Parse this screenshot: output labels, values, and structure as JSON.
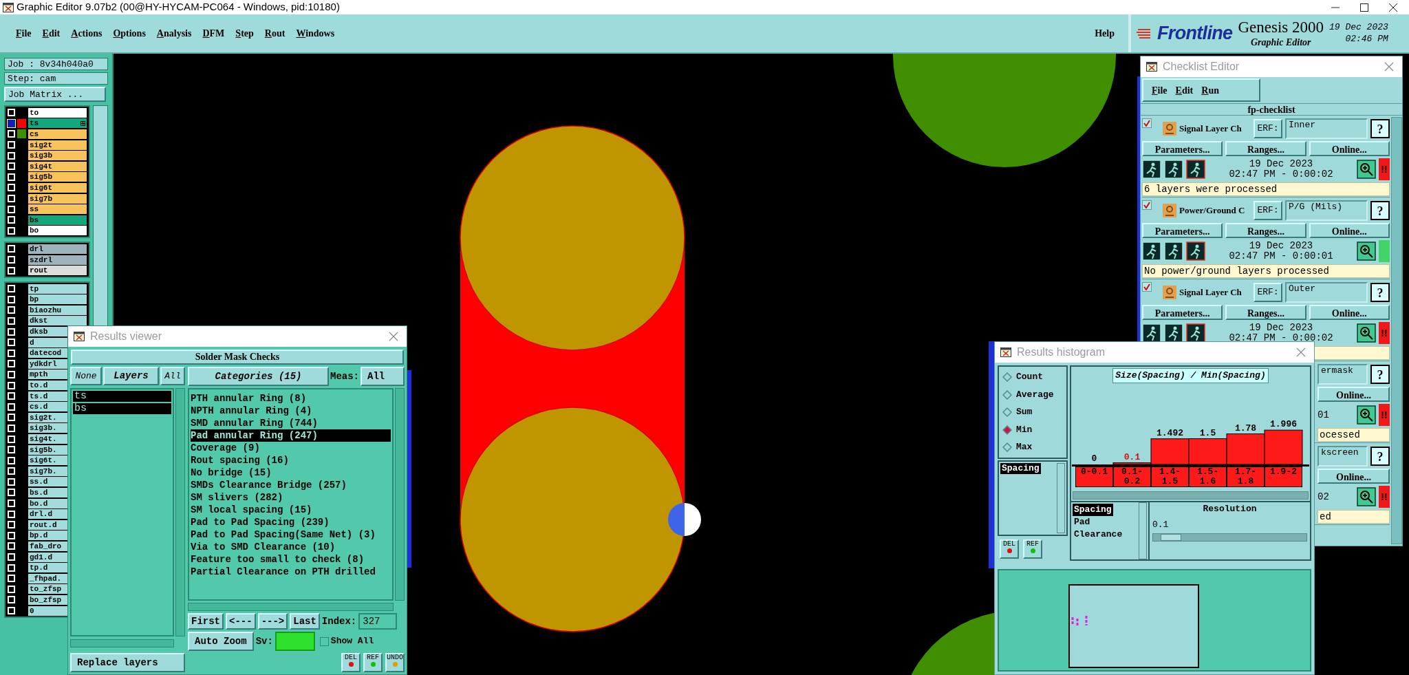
{
  "app": {
    "title": "Graphic Editor 9.07b2 (00@HY-HYCAM-PC064 - Windows, pid:10180)",
    "menu": [
      "File",
      "Edit",
      "Actions",
      "Options",
      "Analysis",
      "DFM",
      "Step",
      "Rout",
      "Windows"
    ],
    "help": "Help",
    "logo": {
      "brand": "Frontline",
      "product": "Genesis 2000",
      "subtitle": "Graphic Editor",
      "date": "19 Dec 2023",
      "time": "02:46 PM"
    }
  },
  "job_panel": {
    "job": "Job : 8v34h040a0",
    "step": "Step: cam",
    "matrix_button": "Job Matrix ...",
    "layer_groups": [
      [
        {
          "name": "to",
          "kind": "silk_screen",
          "affected": false,
          "work": false
        },
        {
          "name": "ts",
          "kind": "solder_mask",
          "affected": true,
          "work": true,
          "color": "#ff0000"
        },
        {
          "name": "cs",
          "kind": "signal",
          "affected": false,
          "work": false,
          "color": "#3f8f00"
        },
        {
          "name": "sig2t",
          "kind": "signal",
          "affected": false,
          "work": false
        },
        {
          "name": "sig3b",
          "kind": "signal",
          "affected": false,
          "work": false
        },
        {
          "name": "sig4t",
          "kind": "signal",
          "affected": false,
          "work": false
        },
        {
          "name": "sig5b",
          "kind": "signal",
          "affected": false,
          "work": false
        },
        {
          "name": "sig6t",
          "kind": "signal",
          "affected": false,
          "work": false
        },
        {
          "name": "sig7b",
          "kind": "signal",
          "affected": false,
          "work": false
        },
        {
          "name": "ss",
          "kind": "signal",
          "affected": false,
          "work": false
        },
        {
          "name": "bs",
          "kind": "solder_mask",
          "affected": false,
          "work": false
        },
        {
          "name": "bo",
          "kind": "silk_screen",
          "affected": false,
          "work": false
        }
      ],
      [
        {
          "name": "drl",
          "kind": "drill",
          "affected": false,
          "work": false
        },
        {
          "name": "szdrl",
          "kind": "drill",
          "affected": false,
          "work": false
        },
        {
          "name": "rout",
          "kind": "rout",
          "affected": false,
          "work": false
        }
      ],
      [
        {
          "name": "tp",
          "kind": "misc",
          "affected": false,
          "work": false
        },
        {
          "name": "bp",
          "kind": "misc",
          "affected": false,
          "work": false
        },
        {
          "name": "biaozhu",
          "kind": "misc",
          "affected": false,
          "work": false
        },
        {
          "name": "dkst",
          "kind": "misc",
          "affected": false,
          "work": false
        },
        {
          "name": "dksb",
          "kind": "misc",
          "affected": false
        },
        {
          "name": "d",
          "kind": "misc",
          "affected": false
        },
        {
          "name": "datecod",
          "kind": "misc",
          "affected": false
        },
        {
          "name": "ydkdrl",
          "kind": "misc",
          "affected": false
        },
        {
          "name": "mpth",
          "kind": "misc",
          "affected": false
        },
        {
          "name": "to.d",
          "kind": "misc",
          "affected": false
        },
        {
          "name": "ts.d",
          "kind": "misc",
          "affected": false
        },
        {
          "name": "cs.d",
          "kind": "misc",
          "affected": false
        },
        {
          "name": "sig2t.",
          "kind": "misc",
          "affected": false
        },
        {
          "name": "sig3b.",
          "kind": "misc",
          "affected": false
        },
        {
          "name": "sig4t.",
          "kind": "misc",
          "affected": false
        },
        {
          "name": "sig5b.",
          "kind": "misc",
          "affected": false
        },
        {
          "name": "sig6t.",
          "kind": "misc",
          "affected": false
        },
        {
          "name": "sig7b.",
          "kind": "misc",
          "affected": false
        },
        {
          "name": "ss.d",
          "kind": "misc",
          "affected": false
        },
        {
          "name": "bs.d",
          "kind": "misc",
          "affected": false
        },
        {
          "name": "bo.d",
          "kind": "misc",
          "affected": false
        },
        {
          "name": "drl.d",
          "kind": "misc",
          "affected": false
        },
        {
          "name": "rout.d",
          "kind": "misc",
          "affected": false
        },
        {
          "name": "bp.d",
          "kind": "misc",
          "affected": false
        },
        {
          "name": "fab_dro",
          "kind": "misc",
          "affected": false
        },
        {
          "name": "gd1.d",
          "kind": "misc",
          "affected": false
        },
        {
          "name": "tp.d",
          "kind": "misc",
          "affected": false
        },
        {
          "name": "_fhpad.",
          "kind": "misc",
          "affected": false
        },
        {
          "name": "to_zfsp",
          "kind": "misc",
          "affected": false
        },
        {
          "name": "bo_zfsp",
          "kind": "misc",
          "affected": false
        },
        {
          "name": "0",
          "kind": "misc",
          "affected": false
        }
      ]
    ]
  },
  "results_viewer": {
    "title": "Results viewer",
    "header": "Solder Mask Checks",
    "none_button": "None",
    "layers_button": "Layers",
    "all_button": "All",
    "layers": [
      {
        "label": "ts",
        "selected": true
      },
      {
        "label": "bs",
        "selected": true
      }
    ],
    "categories_button": "Categories (15)",
    "meas_label": "Meas:",
    "meas_value": "All",
    "categories": [
      {
        "label": "PTH annular Ring (8)",
        "selected": false
      },
      {
        "label": "NPTH annular Ring (4)",
        "selected": false
      },
      {
        "label": "SMD annular Ring (744)",
        "selected": false
      },
      {
        "label": "Pad annular Ring (247)",
        "selected": true
      },
      {
        "label": "Coverage (9)",
        "selected": false
      },
      {
        "label": "Rout spacing (16)",
        "selected": false
      },
      {
        "label": "No bridge (15)",
        "selected": false
      },
      {
        "label": "SMDs Clearance Bridge (257)",
        "selected": false
      },
      {
        "label": "SM slivers (282)",
        "selected": false
      },
      {
        "label": "SM local spacing (15)",
        "selected": false
      },
      {
        "label": "Pad to Pad Spacing (239)",
        "selected": false
      },
      {
        "label": "Pad to Pad Spacing(Same Net) (3)",
        "selected": false
      },
      {
        "label": "Via to SMD Clearance (10)",
        "selected": false
      },
      {
        "label": "Feature too small to check (8)",
        "selected": false
      },
      {
        "label": "Partial Clearance on PTH drilled",
        "selected": false
      }
    ],
    "nav_buttons": [
      "First",
      "<---",
      "--->",
      "Last"
    ],
    "index_label": "Index:",
    "index_value": "327",
    "zoom_mode": "Auto Zoom",
    "sv_label": "Sv:",
    "show_all": {
      "label": "Show All",
      "checked": false
    },
    "action_buttons": [
      "DEL",
      "REF",
      "UNDO"
    ],
    "replace_mode": "Replace layers"
  },
  "checklist_editor": {
    "title": "Checklist Editor",
    "menu": [
      "File",
      "Edit",
      "Run"
    ],
    "checklist": "fp-checklist",
    "items": [
      {
        "kind": "full",
        "checked": true,
        "name": "Signal Layer Ch",
        "erf_label": "ERF:",
        "erf": "Inner",
        "help": "?",
        "buttons": [
          "Parameters...",
          "Ranges...",
          "Online..."
        ],
        "date": "19 Dec 2023",
        "time": "02:47 PM - 0:00:02",
        "failed": true,
        "status_mark": "!!",
        "message": "6 layers were processed"
      },
      {
        "kind": "full",
        "checked": true,
        "name": "Power/Ground C",
        "erf_label": "ERF:",
        "erf": "P/G (Mils)",
        "help": "?",
        "buttons": [
          "Parameters...",
          "Ranges...",
          "Online..."
        ],
        "date": "19 Dec 2023",
        "time": "02:47 PM - 0:00:01",
        "failed": false,
        "message": "No power/ground layers processed"
      },
      {
        "kind": "full",
        "checked": true,
        "name": "Signal Layer Ch",
        "erf_label": "ERF:",
        "erf": "Outer",
        "help": "?",
        "buttons": [
          "Parameters...",
          "Ranges...",
          "Online..."
        ],
        "date": "19 Dec 2023",
        "time": "02:47 PM - 0:00:02",
        "failed": true,
        "status_mark": "!!"
      },
      {
        "kind": "partial",
        "erf": "ermask",
        "help": "?",
        "buttons": [
          "Online..."
        ],
        "date": "01",
        "failed": true,
        "status_mark": "!!",
        "message": "ocessed"
      },
      {
        "kind": "partial",
        "erf": "kscreen",
        "help": "?",
        "buttons": [
          "Online..."
        ],
        "date": "02",
        "failed": true,
        "status_mark": "!!",
        "message": "ed"
      }
    ]
  },
  "results_histogram": {
    "title": "Results histogram",
    "functions": [
      {
        "label": "Count",
        "selected": false
      },
      {
        "label": "Average",
        "selected": false
      },
      {
        "label": "Sum",
        "selected": false
      },
      {
        "label": "Min",
        "selected": true
      },
      {
        "label": "Max",
        "selected": false
      }
    ],
    "measures": [
      {
        "label": "Spacing",
        "selected": true
      }
    ],
    "buttons": [
      "DEL",
      "REF"
    ],
    "chart_data": {
      "type": "bar",
      "title": "Size(Spacing) / Min(Spacing)",
      "categories": [
        "0-0.1",
        "0.1-0.2",
        "1.4-1.5",
        "1.5-1.6",
        "1.7-1.8",
        "1.9-2"
      ],
      "values": [
        0,
        0.1,
        1.492,
        1.5,
        1.78,
        1.996
      ],
      "data_labels": true
    },
    "bins": [
      {
        "selected": false
      },
      {
        "selected": true
      },
      {
        "selected": false
      },
      {
        "selected": false
      },
      {
        "selected": false
      },
      {
        "selected": false
      }
    ],
    "attributes": [
      {
        "label": "Spacing",
        "selected": true
      },
      {
        "label": "Pad",
        "selected": false
      },
      {
        "label": "Clearance",
        "selected": false
      }
    ],
    "resolution": {
      "label": "Resolution",
      "value": "0.1",
      "level": 0.05
    }
  }
}
